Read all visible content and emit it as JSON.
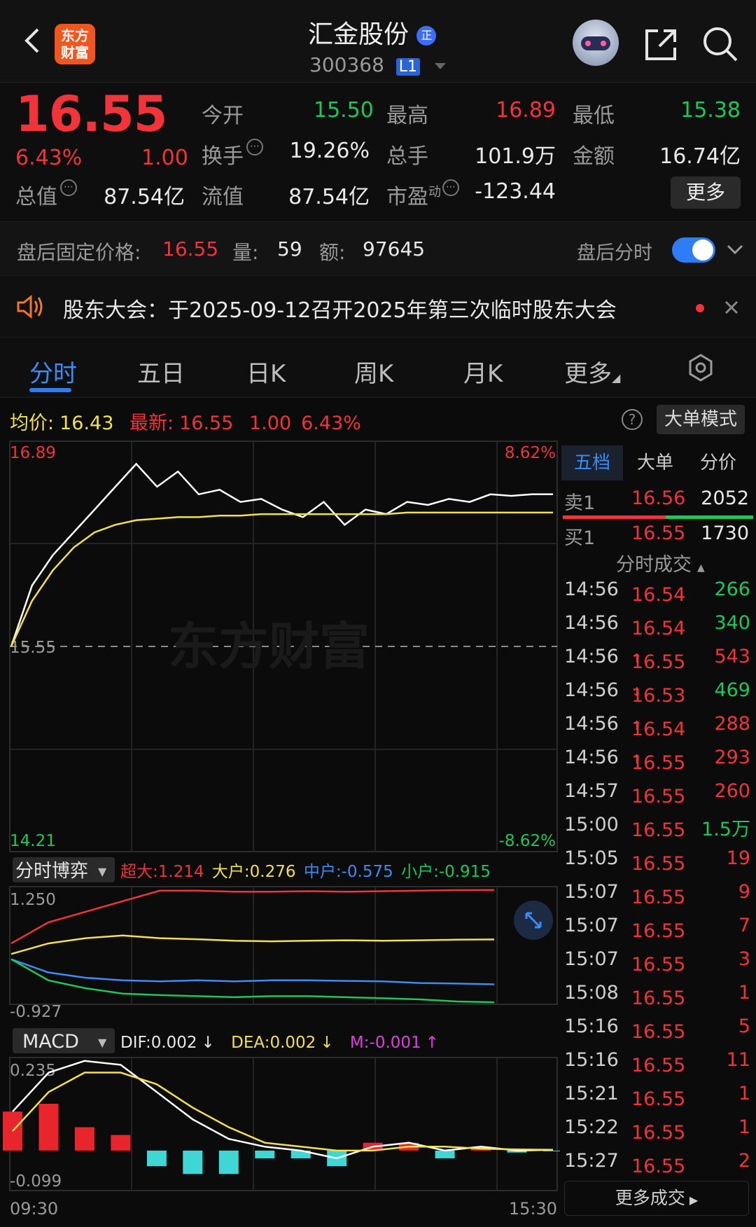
{
  "header": {
    "logo_text": "东方财富",
    "stock_name": "汇金股份",
    "badge": "正",
    "stock_code": "300368",
    "level_badge": "L1"
  },
  "quote": {
    "price": "16.55",
    "change_pct": "6.43%",
    "change": "1.00",
    "fields": {
      "open_label": "今开",
      "open": "15.50",
      "high_label": "最高",
      "high": "16.89",
      "low_label": "最低",
      "low": "15.38",
      "turnover_label": "换手",
      "turnover": "19.26%",
      "volume_label": "总手",
      "volume": "101.9万",
      "amount_label": "金额",
      "amount": "16.74亿",
      "mktcap_label": "总值",
      "mktcap": "87.54亿",
      "float_label": "流值",
      "float": "87.54亿",
      "pe_label": "市盈",
      "pe_sup": "动",
      "pe": "-123.44"
    },
    "more_button": "更多"
  },
  "after_hours": {
    "label": "盘后固定价格:",
    "price": "16.55",
    "vol_label": "量:",
    "vol": "59",
    "amt_label": "额:",
    "amt": "97645",
    "toggle_label": "盘后分时",
    "toggle_on": true
  },
  "notice": {
    "text": "股东大会：于2025-09-12召开2025年第三次临时股东大会"
  },
  "tabs": [
    "分时",
    "五日",
    "日K",
    "周K",
    "月K",
    "更多"
  ],
  "active_tab": "分时",
  "info_bar": {
    "avg_label": "均价:",
    "avg": "16.43",
    "latest_label": "最新:",
    "latest": "16.55",
    "change": "1.00",
    "change_pct": "6.43%",
    "mode_button": "大单模式"
  },
  "main_chart_labels": {
    "y_top": "16.89",
    "y_mid": "15.55",
    "y_bot": "14.21",
    "pct_top": "8.62%",
    "pct_bot": "-8.62%",
    "watermark": "东方财富"
  },
  "order_book": {
    "tabs": [
      "五档",
      "大单",
      "分价"
    ],
    "active_tab": "五档",
    "sell": {
      "label": "卖1",
      "price": "16.56",
      "vol": "2052"
    },
    "buy": {
      "label": "买1",
      "price": "16.55",
      "vol": "1730"
    }
  },
  "trades": {
    "header": "分时成交",
    "rows": [
      {
        "time": "14:56",
        "price": "16.54",
        "vol": "266",
        "arrow": "",
        "vol_color": "green"
      },
      {
        "time": "14:56",
        "price": "16.54",
        "vol": "340",
        "arrow": "",
        "vol_color": "green"
      },
      {
        "time": "14:56",
        "price": "16.55",
        "vol": "543",
        "arrow": "↑",
        "vol_color": "red"
      },
      {
        "time": "14:56",
        "price": "16.53",
        "vol": "469",
        "arrow": "↓",
        "vol_color": "green"
      },
      {
        "time": "14:56",
        "price": "16.54",
        "vol": "288",
        "arrow": "↑",
        "vol_color": "red"
      },
      {
        "time": "14:56",
        "price": "16.55",
        "vol": "293",
        "arrow": "↑",
        "vol_color": "red"
      },
      {
        "time": "14:57",
        "price": "16.55",
        "vol": "260",
        "arrow": "",
        "vol_color": "red"
      },
      {
        "time": "15:00",
        "price": "16.55",
        "vol": "1.5万",
        "arrow": "",
        "vol_color": "green"
      },
      {
        "time": "15:05",
        "price": "16.55",
        "vol": "19",
        "arrow": "",
        "vol_color": "red"
      },
      {
        "time": "15:07",
        "price": "16.55",
        "vol": "9",
        "arrow": "",
        "vol_color": "red"
      },
      {
        "time": "15:07",
        "price": "16.55",
        "vol": "7",
        "arrow": "",
        "vol_color": "red"
      },
      {
        "time": "15:07",
        "price": "16.55",
        "vol": "3",
        "arrow": "",
        "vol_color": "red"
      },
      {
        "time": "15:08",
        "price": "16.55",
        "vol": "1",
        "arrow": "",
        "vol_color": "red"
      },
      {
        "time": "15:16",
        "price": "16.55",
        "vol": "5",
        "arrow": "",
        "vol_color": "red"
      },
      {
        "time": "15:16",
        "price": "16.55",
        "vol": "11",
        "arrow": "",
        "vol_color": "red"
      },
      {
        "time": "15:21",
        "price": "16.55",
        "vol": "1",
        "arrow": "",
        "vol_color": "red"
      },
      {
        "time": "15:22",
        "price": "16.55",
        "vol": "1",
        "arrow": "",
        "vol_color": "red"
      },
      {
        "time": "15:27",
        "price": "16.55",
        "vol": "2",
        "arrow": "",
        "vol_color": "red"
      }
    ],
    "more_button": "更多成交"
  },
  "fund_flow": {
    "selector": "分时博弈",
    "legend": [
      {
        "label": "超大:",
        "value": "1.214",
        "color": "#f0343a"
      },
      {
        "label": "大户:",
        "value": "0.276",
        "color": "#f4e04d"
      },
      {
        "label": "中户:",
        "value": "-0.575",
        "color": "#3d8bf5"
      },
      {
        "label": "小户:",
        "value": "-0.915",
        "color": "#1ec75a"
      }
    ],
    "y_top": "1.250",
    "y_bot": "-0.927"
  },
  "macd": {
    "selector": "MACD",
    "dif_label": "DIF:",
    "dif": "0.002",
    "dif_arrow": "↓",
    "dea_label": "DEA:",
    "dea": "0.002",
    "dea_arrow": "↓",
    "m_label": "M:",
    "m": "-0.001",
    "m_arrow": "↑",
    "y_top": "0.235",
    "y_bot": "-0.099"
  },
  "time_axis": {
    "start": "09:30",
    "end": "15:30"
  },
  "chart_data": [
    {
      "type": "line",
      "title": "",
      "ylim": [
        14.21,
        16.89
      ],
      "x_range": [
        "09:30",
        "15:30"
      ],
      "series": [
        {
          "values": [
            15.55,
            15.95,
            16.15,
            16.3,
            16.45,
            16.6,
            16.75,
            16.6,
            16.7,
            16.55,
            16.58,
            16.5,
            16.52,
            16.45,
            16.4,
            16.5,
            16.35,
            16.45,
            16.42,
            16.5,
            16.48,
            16.52,
            16.5,
            16.55,
            16.54,
            16.55,
            16.55
          ]
        },
        {
          "values": [
            15.55,
            15.85,
            16.05,
            16.2,
            16.3,
            16.35,
            16.38,
            16.39,
            16.4,
            16.4,
            16.41,
            16.41,
            16.42,
            16.42,
            16.42,
            16.42,
            16.42,
            16.42,
            16.42,
            16.43,
            16.43,
            16.43,
            16.43,
            16.43,
            16.43,
            16.43,
            16.43
          ]
        }
      ]
    },
    {
      "type": "line",
      "title": "",
      "ylim": [
        -0.927,
        1.25
      ],
      "series": [
        {
          "name": "超大",
          "values": [
            0.2,
            0.6,
            0.8,
            1.0,
            1.2,
            1.2,
            1.18,
            1.18,
            1.19,
            1.18,
            1.19,
            1.2,
            1.21,
            1.214
          ]
        },
        {
          "name": "大户",
          "values": [
            0.0,
            0.2,
            0.3,
            0.35,
            0.3,
            0.28,
            0.25,
            0.24,
            0.25,
            0.26,
            0.25,
            0.26,
            0.27,
            0.276
          ]
        },
        {
          "name": "中户",
          "values": [
            -0.1,
            -0.35,
            -0.45,
            -0.5,
            -0.52,
            -0.5,
            -0.52,
            -0.5,
            -0.5,
            -0.51,
            -0.52,
            -0.55,
            -0.56,
            -0.575
          ]
        },
        {
          "name": "小户",
          "values": [
            -0.1,
            -0.5,
            -0.65,
            -0.75,
            -0.78,
            -0.8,
            -0.82,
            -0.8,
            -0.8,
            -0.82,
            -0.84,
            -0.86,
            -0.9,
            -0.915
          ]
        }
      ]
    },
    {
      "type": "bar",
      "title": "",
      "ylim": [
        -0.099,
        0.235
      ],
      "series": [
        {
          "name": "DIF",
          "values": [
            0.1,
            0.2,
            0.23,
            0.22,
            0.15,
            0.08,
            0.03,
            0.01,
            0.0,
            -0.02,
            0.01,
            0.02,
            0.0,
            0.01,
            0.0,
            0.002
          ]
        },
        {
          "name": "DEA",
          "values": [
            0.05,
            0.15,
            0.2,
            0.2,
            0.17,
            0.11,
            0.06,
            0.02,
            0.01,
            0.0,
            0.0,
            0.01,
            0.01,
            0.005,
            0.003,
            0.002
          ]
        },
        {
          "name": "M",
          "values": [
            0.1,
            0.12,
            0.06,
            0.04,
            -0.04,
            -0.06,
            -0.06,
            -0.02,
            -0.02,
            -0.04,
            0.02,
            0.02,
            -0.02,
            0.01,
            -0.005,
            -0.001
          ]
        }
      ]
    }
  ]
}
